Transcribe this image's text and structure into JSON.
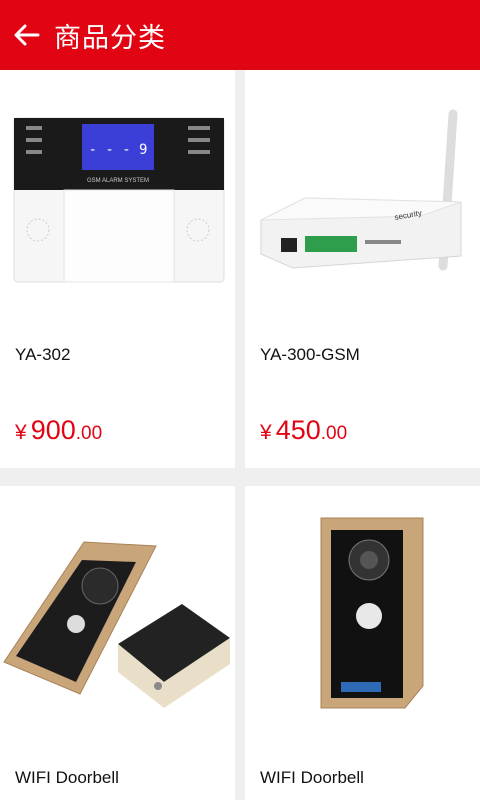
{
  "header": {
    "title": "商品分类",
    "back_icon": "arrow-left-icon"
  },
  "theme": {
    "accent": "#e10514",
    "background": "#efefef"
  },
  "products": [
    {
      "name": "YA-302",
      "currency": "¥",
      "price_int": "900",
      "price_dec": ".00"
    },
    {
      "name": "YA-300-GSM",
      "currency": "¥",
      "price_int": "450",
      "price_dec": ".00"
    },
    {
      "name": "WIFI Doorbell"
    },
    {
      "name": "WIFI Doorbell"
    }
  ]
}
